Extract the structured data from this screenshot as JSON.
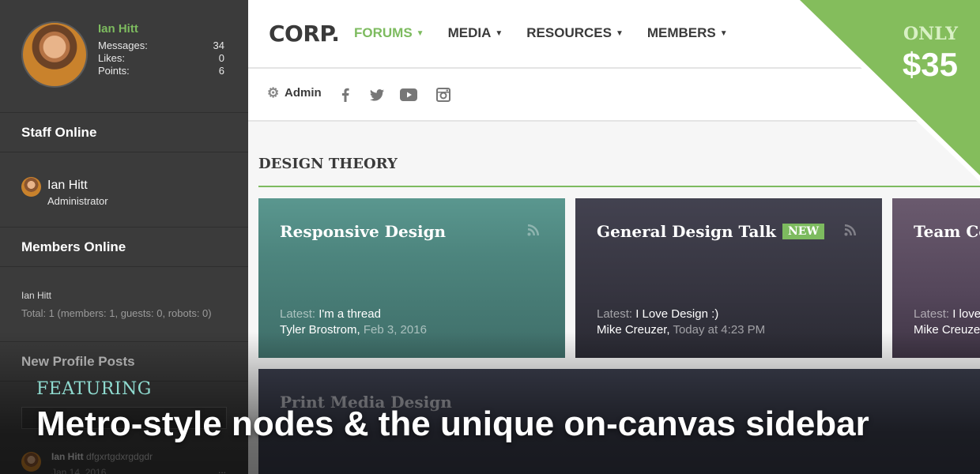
{
  "sidebar": {
    "profile": {
      "name": "Ian Hitt",
      "stats": [
        {
          "label": "Messages:",
          "value": "34"
        },
        {
          "label": "Likes:",
          "value": "0"
        },
        {
          "label": "Points:",
          "value": "6"
        }
      ]
    },
    "staff_heading": "Staff Online",
    "staff": {
      "name": "Ian Hitt",
      "role": "Administrator"
    },
    "members_heading": "Members Online",
    "members": {
      "name": "Ian Hitt",
      "total": "Total: 1 (members: 1, guests: 0, robots: 0)"
    },
    "profile_posts_heading": "New Profile Posts",
    "profile_post": {
      "user": "Ian Hitt",
      "text": "dfgxrtgdxrgdgdr",
      "date": "Jan 14, 2016",
      "more": "..."
    }
  },
  "header": {
    "logo": "CORP.",
    "nav": [
      {
        "label": "FORUMS",
        "active": true
      },
      {
        "label": "MEDIA",
        "active": false
      },
      {
        "label": "RESOURCES",
        "active": false
      },
      {
        "label": "MEMBERS",
        "active": false
      }
    ],
    "admin_label": "Admin",
    "social_icons": [
      "facebook-icon",
      "twitter-icon",
      "youtube-icon",
      "instagram-icon"
    ]
  },
  "promo": {
    "only": "ONLY",
    "price": "$35",
    "color": "#84bd5c"
  },
  "content": {
    "section_title": "DESIGN THEORY",
    "tiles": [
      {
        "title": "Responsive Design",
        "badge": "",
        "latest_label": "Latest:",
        "latest": "I'm a thread",
        "author": "Tyler Brostrom,",
        "date": "Feb 3, 2016",
        "color": "#4f8a82"
      },
      {
        "title": "General Design Talk",
        "badge": "NEW",
        "latest_label": "Latest:",
        "latest": "I Love Design :)",
        "author": "Mike Creuzer,",
        "date": "Today at 4:23 PM",
        "color": "#3c3b48"
      },
      {
        "title": "Team Co",
        "badge": "",
        "latest_label": "Latest:",
        "latest": "I love",
        "author": "Mike Creuze",
        "date": "",
        "color": "#5e4e62"
      }
    ],
    "wide_tile_title": "Print Media Design"
  },
  "overlay": {
    "featuring": "FEATURING",
    "headline": "Metro-style nodes & the unique on-canvas sidebar"
  }
}
